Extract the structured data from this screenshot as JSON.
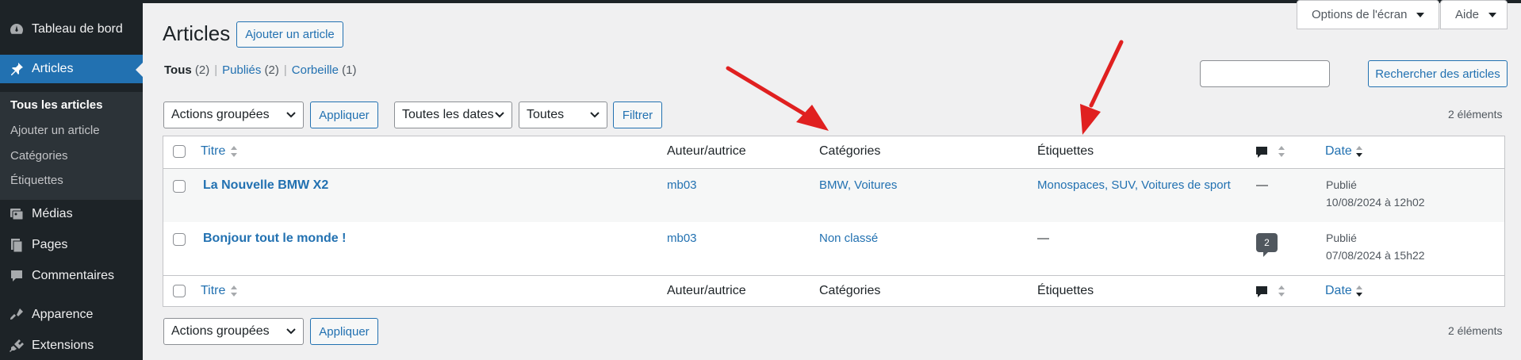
{
  "sidebar": {
    "items": [
      {
        "label": "Tableau de bord",
        "icon": "dashboard-icon"
      },
      {
        "label": "Articles",
        "icon": "pin-icon"
      },
      {
        "label": "Médias",
        "icon": "media-icon"
      },
      {
        "label": "Pages",
        "icon": "pages-icon"
      },
      {
        "label": "Commentaires",
        "icon": "comments-icon"
      },
      {
        "label": "Apparence",
        "icon": "appearance-icon"
      },
      {
        "label": "Extensions",
        "icon": "plugins-icon"
      }
    ],
    "submenu": [
      "Tous les articles",
      "Ajouter un article",
      "Catégories",
      "Étiquettes"
    ]
  },
  "header": {
    "title": "Articles",
    "add_new": "Ajouter un article",
    "screen_options": "Options de l'écran",
    "help": "Aide"
  },
  "views": {
    "all": "Tous",
    "all_count": "(2)",
    "published": "Publiés",
    "published_count": "(2)",
    "trash": "Corbeille",
    "trash_count": "(1)"
  },
  "search": {
    "button": "Rechercher des articles",
    "value": ""
  },
  "filters": {
    "bulk_actions": "Actions groupées",
    "apply": "Appliquer",
    "dates": "Toutes les dates",
    "categories": "Toutes",
    "filter": "Filtrer",
    "item_count": "2 éléments"
  },
  "table": {
    "columns": {
      "title": "Titre",
      "author": "Auteur/autrice",
      "categories": "Catégories",
      "tags": "Étiquettes",
      "date": "Date"
    },
    "rows": [
      {
        "title": "La Nouvelle BMW X2",
        "author": "mb03",
        "categories": "BMW, Voitures",
        "tags": "Monospaces, SUV, Voitures de sport",
        "comments": "—",
        "status": "Publié",
        "date": "10/08/2024 à 12h02"
      },
      {
        "title": "Bonjour tout le monde !",
        "author": "mb03",
        "categories": "Non classé",
        "tags": "—",
        "comments": "2",
        "status": "Publié",
        "date": "07/08/2024 à 15h22"
      }
    ]
  },
  "colors": {
    "accent": "#2271b1",
    "sidebar": "#1d2327",
    "annotation_arrow": "#e02020"
  }
}
